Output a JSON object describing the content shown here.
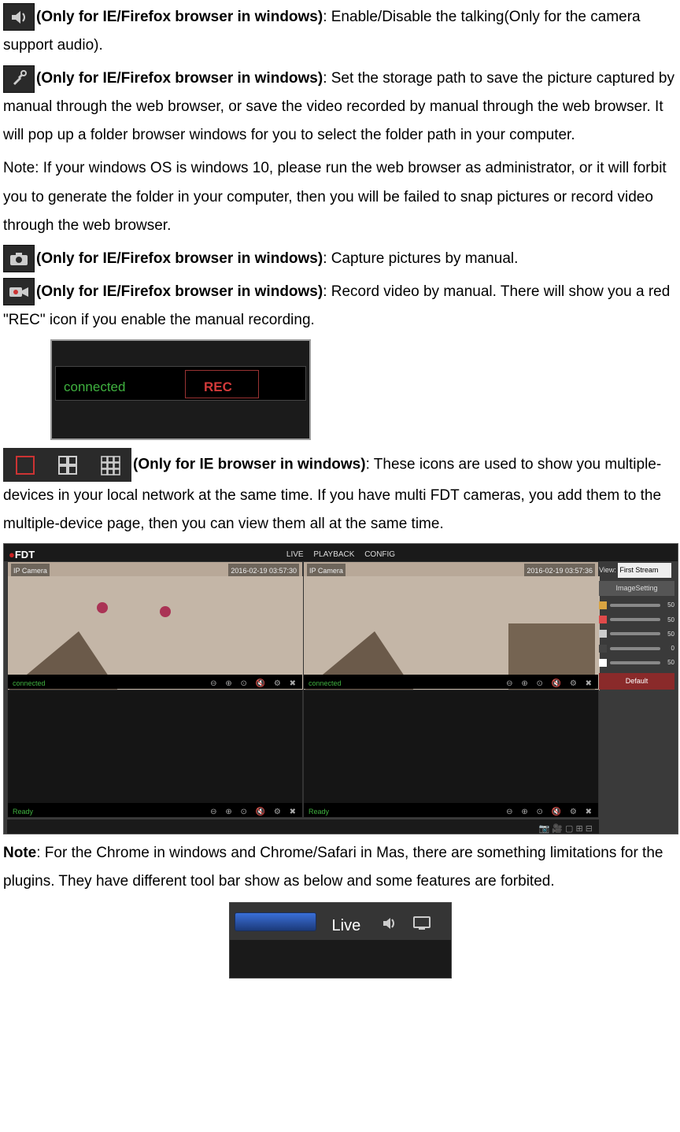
{
  "items": [
    {
      "bold": "(Only for IE/Firefox browser in windows)",
      "text": ": Enable/Disable the talking(Only for the camera support audio)."
    },
    {
      "bold": "(Only for IE/Firefox browser in windows)",
      "text": ": Set the storage path to save the picture captured by manual through the web browser, or save the video recorded by manual through the web browser. It will pop up a folder browser windows for you to select the folder path in your computer."
    }
  ],
  "note_admin": "Note: If your windows OS is windows 10, please run the web browser as administrator, or it will forbit you to generate the folder in your computer, then you will be failed to snap pictures or record video through the web browser.",
  "items2": [
    {
      "bold": "(Only for IE/Firefox browser in windows)",
      "text": ": Capture pictures by manual."
    },
    {
      "bold": "(Only for IE/Firefox browser in windows)",
      "text": ": Record video by manual. There will show you a red \"REC\" icon if you enable the manual recording."
    }
  ],
  "rec": {
    "connected": "connected",
    "rec": "REC"
  },
  "grid": {
    "bold": "(Only for IE browser in windows)",
    "text": ": These icons are used to show you multiple-devices in your local network at the same time. If you have multi FDT cameras, you add them to the multiple-device page, then you can view them all at the same time."
  },
  "quad": {
    "logo_pre": "●",
    "logo_text": "FDT",
    "menu": "LIVE   PLAYBACK   CONFIG",
    "ts_l": "2016-02-19 03:57:30",
    "ts_r": "2016-02-19 03:57:36",
    "cam_label": "IP Camera",
    "bar_connected": "connected",
    "bar_ready": "Ready",
    "vicons": "⊖ ⊕ ⊙  🔇  ⚙ ✖",
    "bottom_icons": "📷  🎥    ▢  ⊞  ⊟",
    "side": {
      "view_label": "View:",
      "view_value": "First Stream",
      "section": "ImageSetting",
      "sliders": [
        {
          "color": "#d9a441",
          "val": "50"
        },
        {
          "color": "#e04a4a",
          "val": "50"
        },
        {
          "color": "#cccccc",
          "val": "50"
        },
        {
          "color": "#444444",
          "val": "0"
        },
        {
          "color": "#ffffff",
          "val": "50"
        }
      ],
      "default": "Default"
    }
  },
  "note2_bold": "Note",
  "note2_text": ": For the Chrome in windows and Chrome/Safari in Mas, there are something limitations for the plugins. They have different tool bar show as below and some features are forbited.",
  "live": {
    "text": "Live"
  }
}
